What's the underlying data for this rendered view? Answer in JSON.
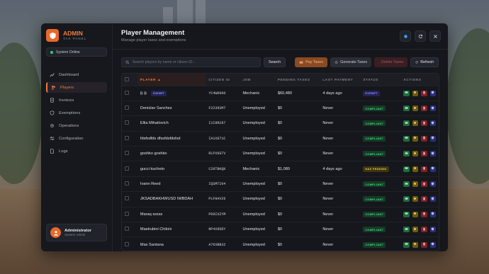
{
  "brand": {
    "title": "ADMIN",
    "subtitle": "TAX PANEL"
  },
  "system_status": "System Online",
  "nav": [
    {
      "label": "Dashboard",
      "icon": "chart-icon"
    },
    {
      "label": "Players",
      "icon": "users-icon",
      "active": true
    },
    {
      "label": "Invoices",
      "icon": "invoice-icon"
    },
    {
      "label": "Exemptions",
      "icon": "shield-icon"
    },
    {
      "label": "Operations",
      "icon": "gear-icon"
    },
    {
      "label": "Configuration",
      "icon": "sliders-icon"
    },
    {
      "label": "Logs",
      "icon": "file-icon"
    }
  ],
  "user": {
    "name": "Administrator",
    "role": "System Admin"
  },
  "header": {
    "title": "Player Management",
    "subtitle": "Manage player taxes and exemptions"
  },
  "toolbar": {
    "search_placeholder": "Search players by name or citizen ID...",
    "search_label": "Search",
    "pay_label": "Pay Taxes",
    "generate_label": "Generate Taxes",
    "delete_label": "Delete Taxes",
    "refresh_label": "Refresh"
  },
  "table": {
    "columns": [
      "PLAYER ▲",
      "CITIZEN ID",
      "JOB",
      "PENDING TAXES",
      "LAST PAYMENT",
      "STATUS",
      "ACTIONS"
    ],
    "rows": [
      {
        "player": "B B",
        "tag": "EXEMPT",
        "citizen_id": "YC4W0000",
        "job": "Mechanic",
        "pending": "$60,480",
        "last_payment": "4 days ago",
        "status": "EXEMPT"
      },
      {
        "player": "Denislav Sanchez",
        "citizen_id": "F2239SM7",
        "job": "Unemployed",
        "pending": "$0",
        "last_payment": "Never",
        "status": "COMPLIANT"
      },
      {
        "player": "Ellia Mihailovich",
        "citizen_id": "I1I8R287",
        "job": "Unemployed",
        "pending": "$0",
        "last_payment": "Never",
        "status": "COMPLIANT"
      },
      {
        "player": "fdsfsdfds dfssfdsfdsfsd",
        "citizen_id": "IA1X871C",
        "job": "Unemployed",
        "pending": "$0",
        "last_payment": "Never",
        "status": "COMPLIANT"
      },
      {
        "player": "goshko goshko",
        "citizen_id": "RLPX6GTV",
        "job": "Unemployed",
        "pending": "$0",
        "last_payment": "Never",
        "status": "COMPLIANT"
      },
      {
        "player": "gucci kucheto",
        "citizen_id": "C28TBKQK",
        "job": "Mechanic",
        "pending": "$1,080",
        "last_payment": "4 days ago",
        "status": "HAS PENDING"
      },
      {
        "player": "Ivann Reed",
        "citizen_id": "IQSMTI04",
        "job": "Unemployed",
        "pending": "$0",
        "last_payment": "Never",
        "status": "COMPLIANT"
      },
      {
        "player": "JKSADBAKHWUSD IWBDAH",
        "citizen_id": "PLFHAV26",
        "job": "Unemployed",
        "pending": "$0",
        "last_payment": "Never",
        "status": "COMPLIANT"
      },
      {
        "player": "Maraq sssss",
        "citizen_id": "P09IXZYM",
        "job": "Unemployed",
        "pending": "$0",
        "last_payment": "Never",
        "status": "COMPLIANT"
      },
      {
        "player": "Mastrubini Chikini",
        "citizen_id": "NP4X9DDY",
        "job": "Unemployed",
        "pending": "$0",
        "last_payment": "Never",
        "status": "COMPLIANT"
      },
      {
        "player": "Max Santana",
        "citizen_id": "A76XBB32",
        "job": "Unemployed",
        "pending": "$0",
        "last_payment": "Never",
        "status": "COMPLIANT"
      }
    ]
  },
  "colors": {
    "accent": "#f07a3a",
    "compliant": "#3ddc84",
    "exempt": "#8b8dff",
    "pending": "#f2c744"
  }
}
